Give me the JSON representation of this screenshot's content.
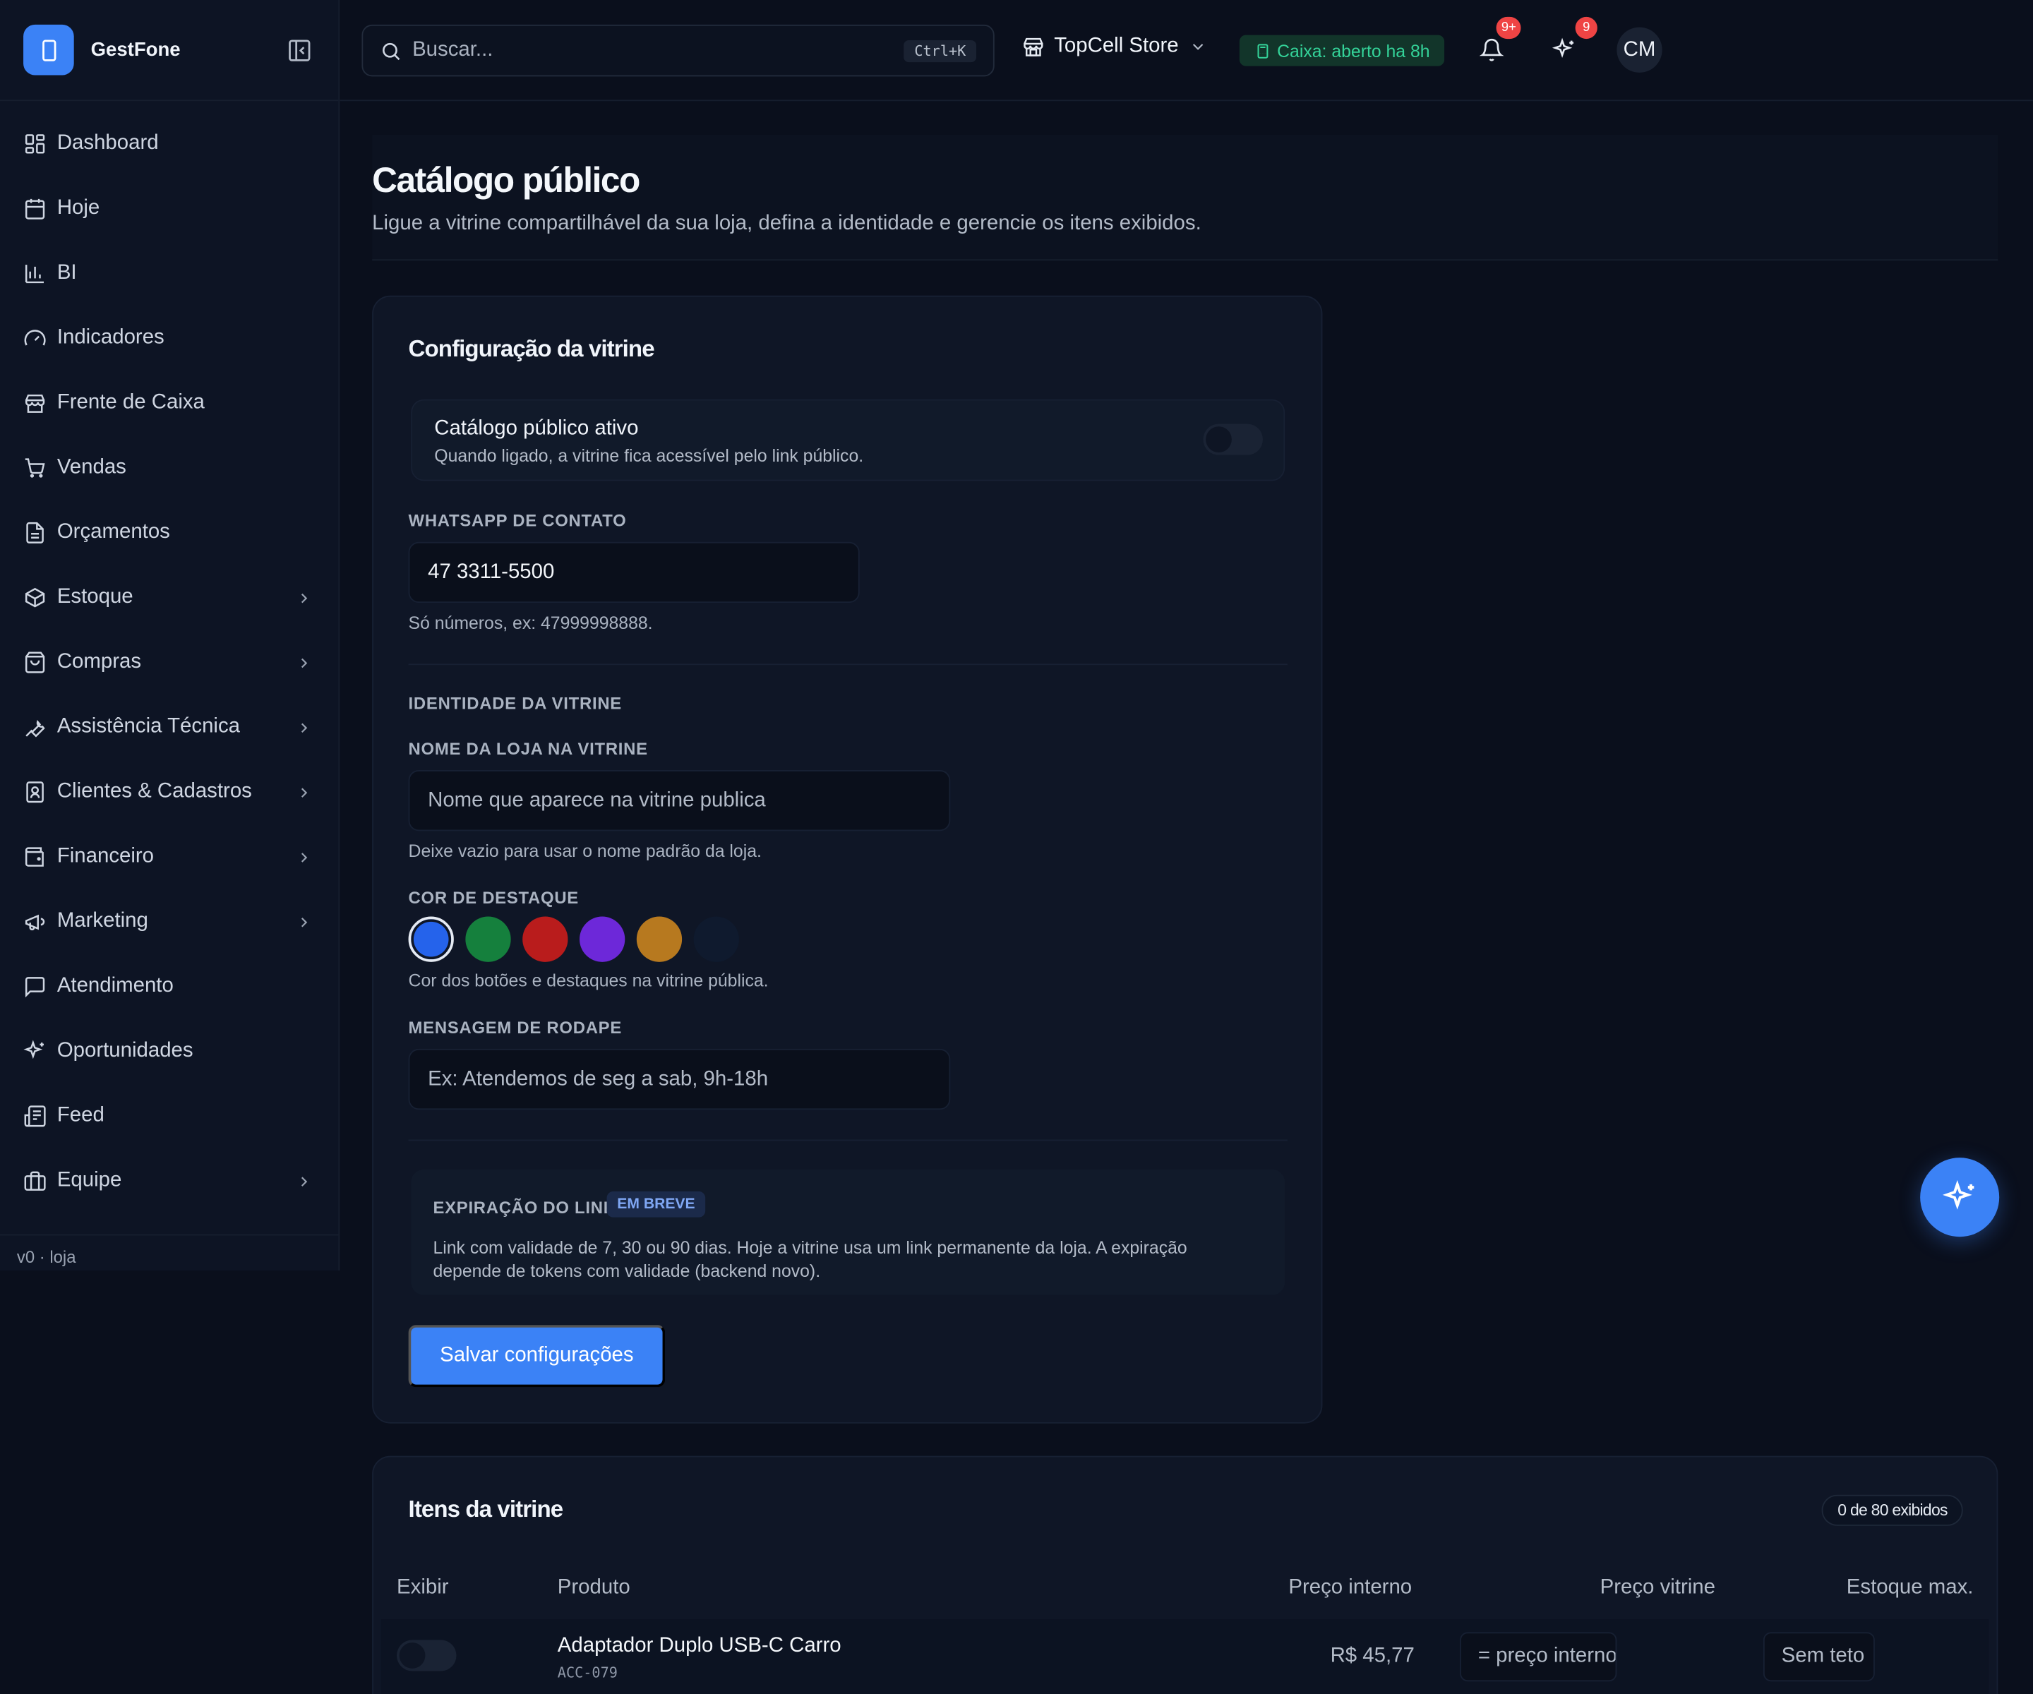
{
  "app": {
    "name": "GestFone",
    "version": "v0 · loja"
  },
  "sidebar": {
    "items": [
      {
        "label": "Dashboard",
        "icon": "layout-grid-icon",
        "has_children": false
      },
      {
        "label": "Hoje",
        "icon": "calendar-icon",
        "has_children": false
      },
      {
        "label": "BI",
        "icon": "bar-chart-icon",
        "has_children": false
      },
      {
        "label": "Indicadores",
        "icon": "gauge-icon",
        "has_children": false
      },
      {
        "label": "Frente de Caixa",
        "icon": "store-icon",
        "has_children": false
      },
      {
        "label": "Vendas",
        "icon": "cart-icon",
        "has_children": false
      },
      {
        "label": "Orçamentos",
        "icon": "file-text-icon",
        "has_children": false
      },
      {
        "label": "Estoque",
        "icon": "package-icon",
        "has_children": true
      },
      {
        "label": "Compras",
        "icon": "shopping-bag-icon",
        "has_children": true
      },
      {
        "label": "Assistência Técnica",
        "icon": "wrench-icon",
        "has_children": true
      },
      {
        "label": "Clientes & Cadastros",
        "icon": "contact-icon",
        "has_children": true
      },
      {
        "label": "Financeiro",
        "icon": "wallet-icon",
        "has_children": true
      },
      {
        "label": "Marketing",
        "icon": "megaphone-icon",
        "has_children": true
      },
      {
        "label": "Atendimento",
        "icon": "message-square-icon",
        "has_children": false
      },
      {
        "label": "Oportunidades",
        "icon": "sparkles-icon",
        "has_children": false
      },
      {
        "label": "Feed",
        "icon": "newspaper-icon",
        "has_children": false
      },
      {
        "label": "Equipe",
        "icon": "briefcase-icon",
        "has_children": true
      }
    ]
  },
  "topbar": {
    "search_placeholder": "Buscar...",
    "search_shortcut": "Ctrl+K",
    "store_name": "TopCell Store",
    "caixa_status": "Caixa: aberto ha 8h",
    "notifications_badge": "9+",
    "opportunities_badge": "9",
    "avatar_initials": "CM"
  },
  "page": {
    "title": "Catálogo público",
    "subtitle": "Ligue a vitrine compartilhável da sua loja, defina a identidade e gerencie os itens exibidos."
  },
  "config": {
    "title": "Configuração da vitrine",
    "toggle_title": "Catálogo público ativo",
    "toggle_desc": "Quando ligado, a vitrine fica acessível pelo link público.",
    "toggle_on": false,
    "whatsapp_label": "WHATSAPP DE CONTATO",
    "whatsapp_value": "47 3311-5500",
    "whatsapp_hint": "Só números, ex: 47999998888.",
    "identity_heading": "IDENTIDADE DA VITRINE",
    "store_name_label": "NOME DA LOJA NA VITRINE",
    "store_name_placeholder": "Nome que aparece na vitrine publica",
    "store_name_hint": "Deixe vazio para usar o nome padrão da loja.",
    "color_label": "COR DE DESTAQUE",
    "colors": [
      "#2563eb",
      "#15803d",
      "#b91c1c",
      "#6d28d9",
      "#b7791f",
      "#0f1a2e"
    ],
    "selected_color": "#2563eb",
    "color_hint": "Cor dos botões e destaques na vitrine pública.",
    "footer_label": "MENSAGEM DE RODAPE",
    "footer_placeholder": "Ex: Atendemos de seg a sab, 9h-18h",
    "expiry_label": "EXPIRAÇÃO DO LINK",
    "expiry_badge": "EM BREVE",
    "expiry_text": "Link com validade de 7, 30 ou 90 dias. Hoje a vitrine usa um link permanente da loja. A expiração depende de tokens com validade (backend novo).",
    "save_label": "Salvar configurações"
  },
  "items": {
    "title": "Itens da vitrine",
    "count": "0 de 80 exibidos",
    "columns": [
      "Exibir",
      "Produto",
      "Preço interno",
      "Preço vitrine",
      "Estoque max."
    ],
    "rows": [
      {
        "product": "Adaptador Duplo USB-C Carro",
        "sku": "ACC-079",
        "internal_price": "R$ 45,77",
        "vitrine_price_placeholder": "= preço interno",
        "stock_placeholder": "Sem teto",
        "shown": false
      }
    ]
  },
  "colors": {
    "accent": "#3b82f6",
    "success": "#34d399",
    "danger": "#ef4444",
    "background": "#0a0f1c"
  }
}
